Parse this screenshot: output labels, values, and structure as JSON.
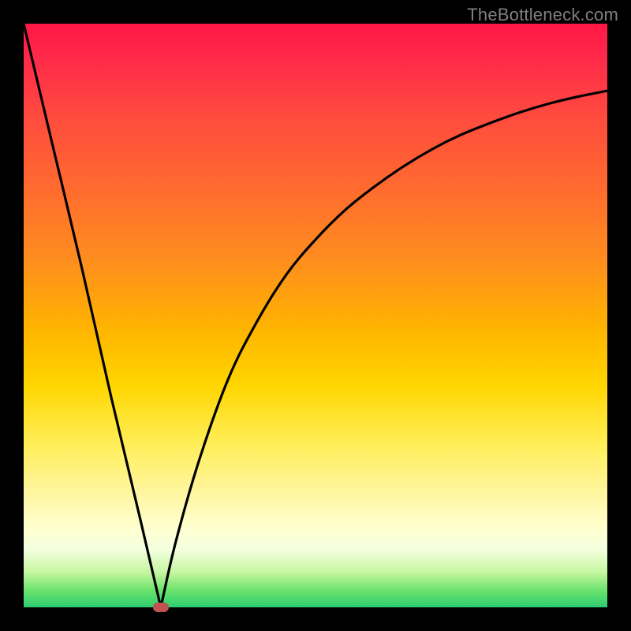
{
  "watermark": {
    "text": "TheBottleneck.com"
  },
  "palette": {
    "frame": "#000000",
    "marker": "#c0524f",
    "curve": "#000000"
  },
  "chart_data": {
    "type": "line",
    "title": "",
    "xlabel": "",
    "ylabel": "",
    "xlim": [
      0,
      100
    ],
    "ylim": [
      0,
      100
    ],
    "series": [
      {
        "name": "left-branch",
        "x": [
          0,
          5,
          10,
          15,
          20,
          23.5
        ],
        "values": [
          100,
          79,
          58,
          36,
          15,
          0
        ]
      },
      {
        "name": "right-branch",
        "x": [
          23.5,
          26,
          30,
          35,
          40,
          45,
          50,
          55,
          60,
          65,
          70,
          75,
          80,
          85,
          90,
          95,
          100
        ],
        "values": [
          0,
          11,
          25,
          39,
          49,
          57,
          63,
          68,
          72,
          75.5,
          78.5,
          81,
          83,
          84.8,
          86.3,
          87.5,
          88.5
        ]
      }
    ],
    "marker": {
      "x": 23.5,
      "y": 0
    },
    "grid": false,
    "legend": false
  }
}
